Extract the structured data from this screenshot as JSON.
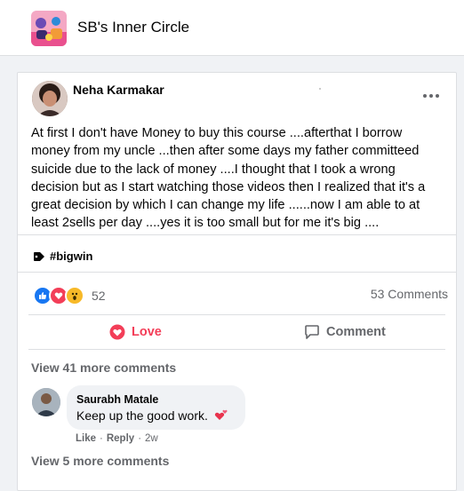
{
  "group": {
    "name": "SB's Inner Circle"
  },
  "post": {
    "author": "Neha Karmakar",
    "text": "At first I don't have Money to buy this course ....afterthat  I  borrow money from my uncle ...then after some days my father committeed suicide due to the lack of money ....I thought that I took a wrong decision but as I start watching those videos then I realized that it's a great decision by which I can change my life ......now I am able to at least 2sells per day ....yes it is too small but for me it's big ....",
    "tag": "#bigwin",
    "reaction_count": "52",
    "comment_count": "53 Comments",
    "reactions": [
      "like-icon",
      "love-icon",
      "wow-icon"
    ]
  },
  "actions": {
    "love_label": "Love",
    "comment_label": "Comment"
  },
  "comments": {
    "view_more_top": "View 41 more comments",
    "view_more_bottom": "View 5 more comments",
    "items": [
      {
        "author": "Saurabh Matale",
        "text": "Keep up the good work.",
        "like_label": "Like",
        "reply_label": "Reply",
        "time": "2w"
      }
    ]
  },
  "colors": {
    "love": "#f33e58",
    "like": "#1877f2",
    "wow": "#f7b928",
    "muted": "#65676b"
  }
}
